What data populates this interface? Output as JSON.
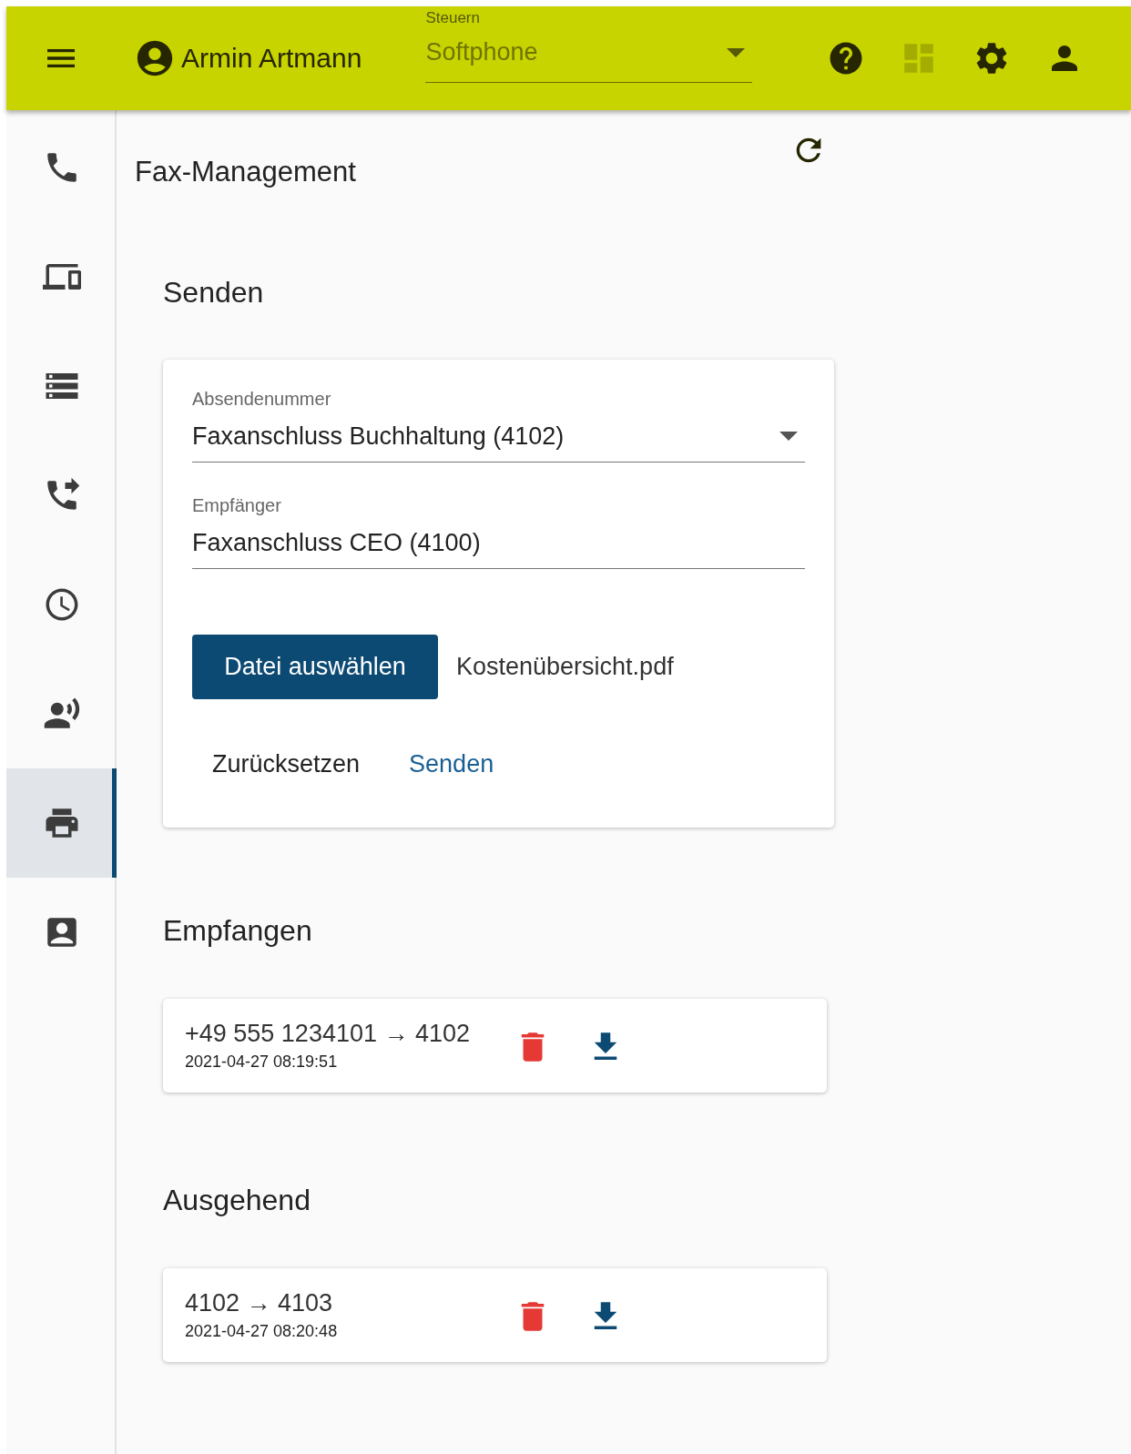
{
  "top_bar": {
    "user": "Armin Artmann",
    "control_select": {
      "label": "Steuern",
      "value": "Softphone"
    },
    "actions": [
      {
        "kind": "help",
        "disabled": false
      },
      {
        "kind": "dashboard",
        "disabled": true
      },
      {
        "kind": "settings",
        "disabled": false
      },
      {
        "kind": "person",
        "disabled": false
      }
    ]
  },
  "sidebar": {
    "items": [
      {
        "kind": "phone",
        "selected": false
      },
      {
        "kind": "devices",
        "selected": false
      },
      {
        "kind": "server",
        "selected": false
      },
      {
        "kind": "forward",
        "selected": false
      },
      {
        "kind": "history",
        "selected": false
      },
      {
        "kind": "voice",
        "selected": false
      },
      {
        "kind": "fax",
        "selected": true
      },
      {
        "kind": "contacts",
        "selected": false
      }
    ]
  },
  "page": {
    "title": "Fax-Management"
  },
  "send": {
    "heading": "Senden",
    "sender": {
      "label": "Absendenummer",
      "value": "Faxanschluss Buchhaltung (4102)"
    },
    "recipient": {
      "label": "Empfänger",
      "value": "Faxanschluss CEO (4100)"
    },
    "file_button": "Datei auswählen",
    "file_name": "Kostenübersicht.pdf",
    "reset_button": "Zurücksetzen",
    "send_button": "Senden"
  },
  "received": {
    "heading": "Empfangen",
    "items": [
      {
        "route": "+49 555 1234101 → 4102",
        "timestamp": "2021-04-27 08:19:51"
      }
    ]
  },
  "outgoing": {
    "heading": "Ausgehend",
    "items": [
      {
        "route": "4102 → 4103",
        "timestamp": "2021-04-27 08:20:48"
      }
    ]
  }
}
